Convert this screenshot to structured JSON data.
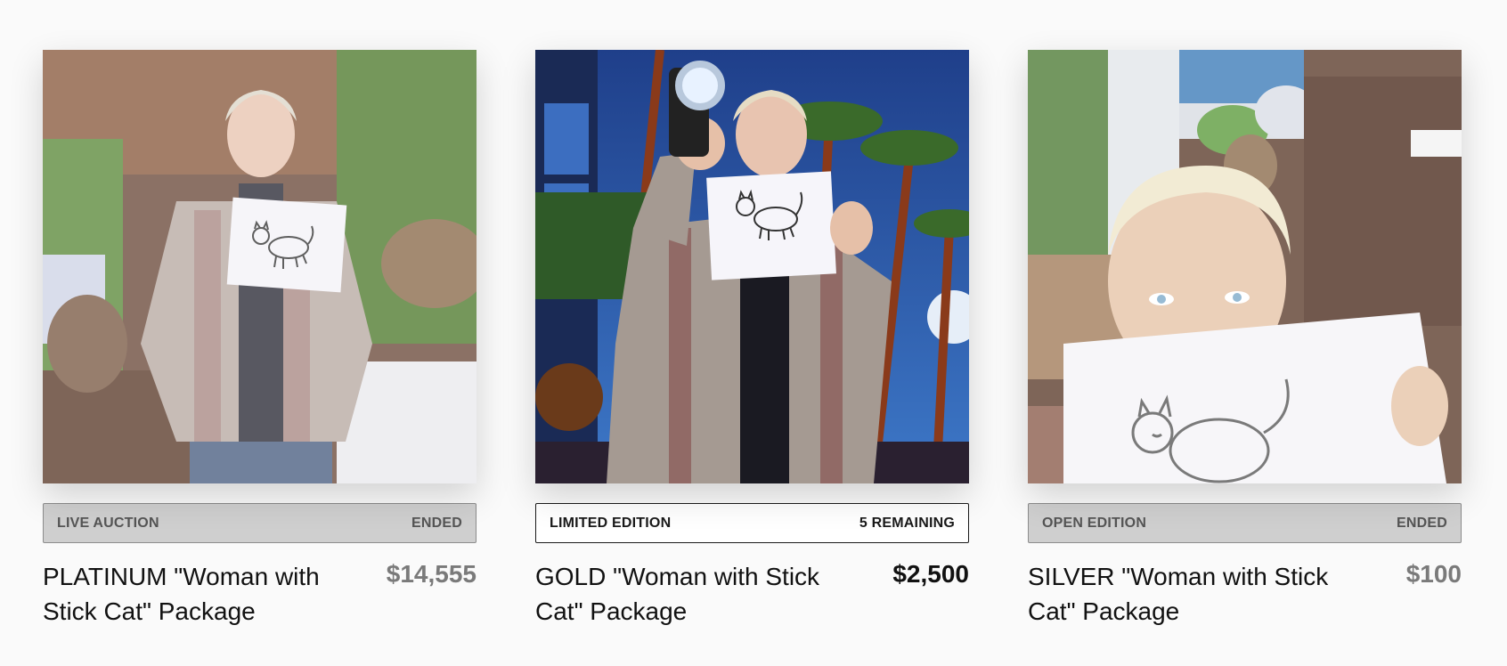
{
  "cards": [
    {
      "image_label": "Ellen holding stick cat drawing on set",
      "edition": "LIVE AUCTION",
      "status": "ENDED",
      "title": "PLATINUM \"Woman with Stick Cat\" Package",
      "price": "$14,555"
    },
    {
      "image_label": "Ellen taking selfie with stick cat drawing",
      "edition": "LIMITED EDITION",
      "status": "5 REMAINING",
      "title": "GOLD \"Woman with Stick Cat\" Package",
      "price": "$2,500"
    },
    {
      "image_label": "Ellen peeking over stick cat drawing",
      "edition": "OPEN EDITION",
      "status": "ENDED",
      "title": "SILVER \"Woman with Stick Cat\" Package",
      "price": "$100"
    }
  ]
}
